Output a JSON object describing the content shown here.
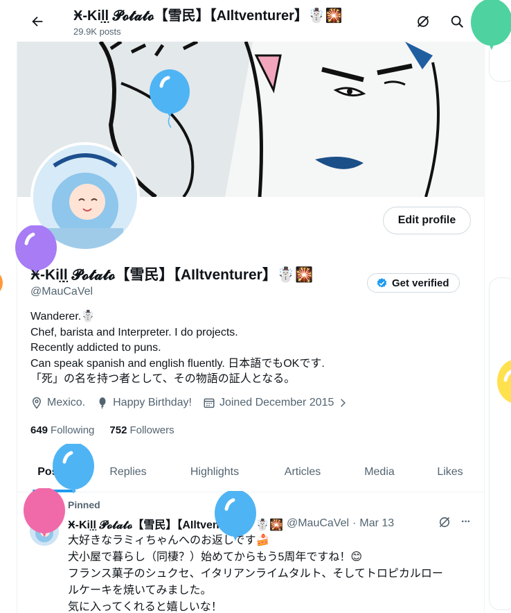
{
  "header": {
    "title": "Ӿ-Kil̤l̤ 𝓟𝓸𝓽𝓪𝓽𝓸【雪民】【AIltventurer】☃️🎇",
    "post_count": "29.9K posts"
  },
  "profile": {
    "display_name": "Ӿ-Kil̤l̤ 𝓟𝓸𝓽𝓪𝓽𝓸【雪民】【AIltventurer】☃️🎇",
    "handle": "@MauCaVel",
    "edit_button": "Edit profile",
    "verify_button": "Get verified",
    "bio": [
      "Wanderer.☃️",
      "Chef, barista and Interpreter. I do projects.",
      "Recently addicted to puns.",
      "Can speak spanish and english fluently. 日本語でもOKです.",
      "「死」の名を持つ者として、その物語の証人となる。"
    ],
    "location": "Mexico.",
    "birthday": "Happy Birthday!",
    "joined": "Joined December 2015",
    "following_count": "649",
    "following_label": "Following",
    "followers_count": "752",
    "followers_label": "Followers"
  },
  "tabs": [
    "Posts",
    "Replies",
    "Highlights",
    "Articles",
    "Media",
    "Likes"
  ],
  "pinned_tweet": {
    "pinned_label": "Pinned",
    "author_name": "Ӿ-Kil̤l̤ 𝓟𝓸𝓽𝓪𝓽𝓸【雪民】【AIltventurer】☃️🎇",
    "author_handle": "@MauCaVel",
    "separator": "·",
    "date": "Mar 13",
    "more": "···",
    "lines": [
      "大好きなラミィちゃんへのお返しです🍰",
      "犬小屋で暮らし（同棲？）始めてからもう5周年ですね！😊",
      "フランス菓子のシュクセ、イタリアンライムタルト、そしてトロピカルロー",
      "ルケーキを焼いてみました。",
      "気に入ってくれると嬉しいな！"
    ]
  },
  "colors": {
    "accent": "#1d9bf0",
    "text": "#0f1419",
    "secondary_text": "#536471",
    "balloon_blue": "#4fb4f4",
    "balloon_green": "#4ed3a0",
    "balloon_purple": "#a77cf5",
    "balloon_pink": "#f06aa9",
    "balloon_yellow": "#ffe14d",
    "balloon_orange": "#ff9a3c"
  },
  "icons": {
    "back": "arrow-left-icon",
    "grok": "grok-icon",
    "search": "search-icon",
    "location": "location-pin-icon",
    "birthday": "balloon-icon",
    "calendar": "calendar-icon",
    "verified": "verified-badge-icon",
    "pin": "pin-icon"
  }
}
